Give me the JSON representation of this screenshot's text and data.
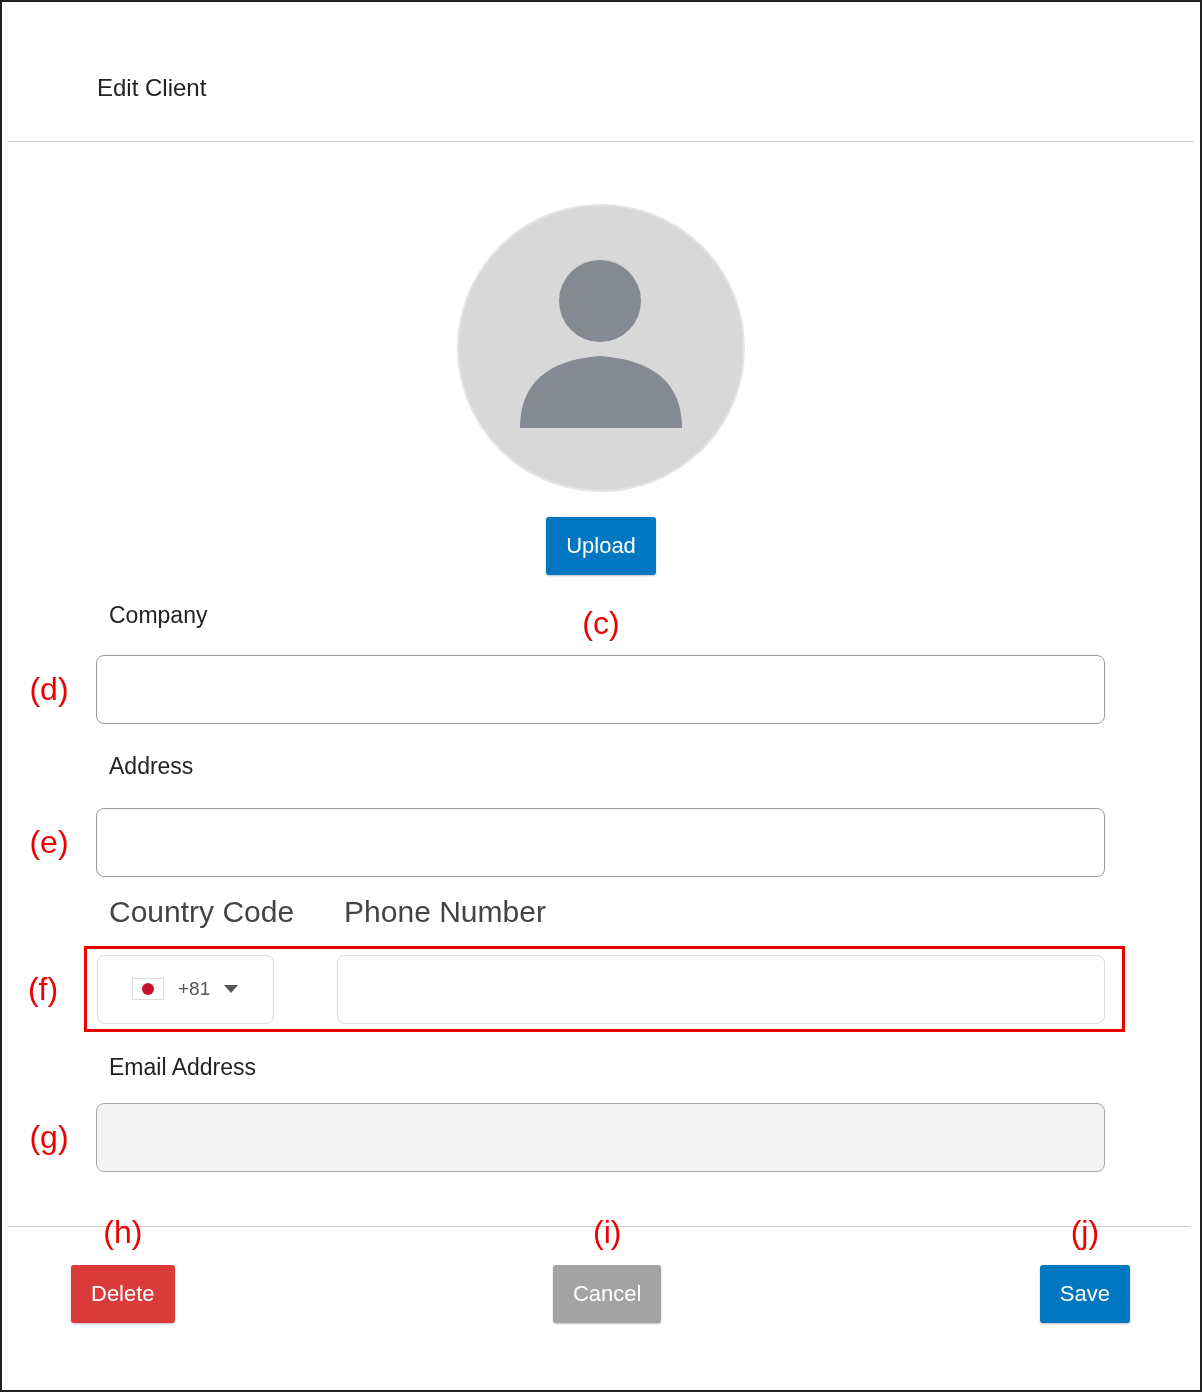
{
  "dialog": {
    "title": "Edit Client"
  },
  "upload": {
    "label": "Upload",
    "annotation": "(c)"
  },
  "fields": [
    {
      "label": "Company",
      "annotation": "(d)"
    },
    {
      "label": "Address",
      "annotation": "(e)"
    }
  ],
  "phone": {
    "country_label": "Country Code",
    "number_label": "Phone Number",
    "code": "+81",
    "annotation": "(f)",
    "highlighted": true
  },
  "email": {
    "label": "Email Address",
    "annotation": "(g)",
    "disabled": true
  },
  "buttons": [
    {
      "kind": "danger",
      "label": "Delete",
      "annotation": "(h)"
    },
    {
      "kind": "neutral",
      "label": "Cancel",
      "annotation": "(i)"
    },
    {
      "kind": "primary",
      "label": "Save",
      "annotation": "(j)"
    }
  ]
}
